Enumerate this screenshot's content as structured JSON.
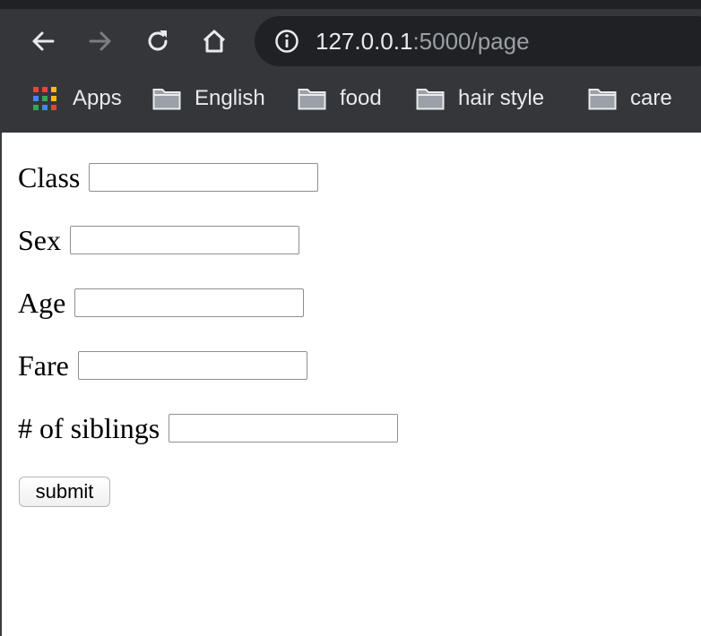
{
  "browser": {
    "nav": {
      "back_icon": "arrow-left-icon",
      "forward_icon": "arrow-right-icon",
      "reload_icon": "reload-icon",
      "home_icon": "home-icon"
    },
    "address_bar": {
      "host": "127.0.0.1",
      "rest": ":5000/page",
      "info_icon": "info-icon"
    },
    "bookmarks": [
      {
        "label": "Apps",
        "icon": "apps-grid-icon"
      },
      {
        "label": "English",
        "icon": "folder-icon"
      },
      {
        "label": "food",
        "icon": "folder-icon"
      },
      {
        "label": "hair style",
        "icon": "folder-icon"
      },
      {
        "label": "care",
        "icon": "folder-icon"
      }
    ]
  },
  "form": {
    "fields": [
      {
        "label": "Class",
        "value": ""
      },
      {
        "label": "Sex",
        "value": ""
      },
      {
        "label": "Age",
        "value": ""
      },
      {
        "label": "Fare",
        "value": ""
      },
      {
        "label": "# of siblings",
        "value": ""
      }
    ],
    "submit_label": "submit"
  },
  "colors": {
    "toolbar_bg": "#35363a",
    "omnibox_bg": "#202124",
    "url_host": "#e8eaed",
    "url_rest": "#9aa0a6"
  }
}
